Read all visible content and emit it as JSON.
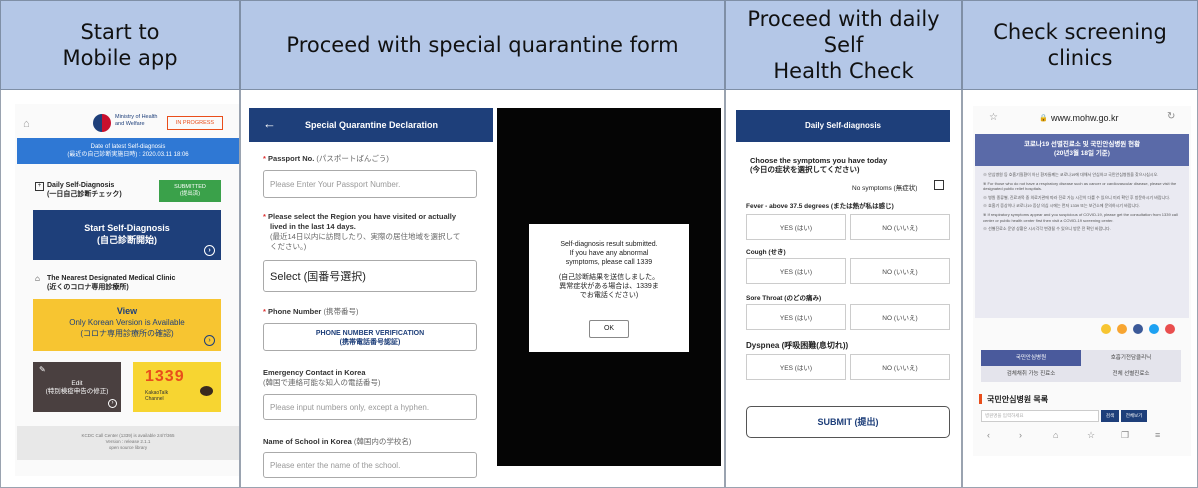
{
  "headers": {
    "col1": [
      "Start to",
      "Mobile app"
    ],
    "col2": "Proceed with special quarantine form",
    "col3": [
      "Proceed with daily Self",
      "Health Check"
    ],
    "col4": "Check screening clinics"
  },
  "app": {
    "ministry": [
      "Ministry of Health",
      "and Welfare"
    ],
    "status_badge": "IN PROGRESS",
    "latest_title": "Date of latest Self-diagnosis",
    "latest_sub": "(最近の自己診断実施日時) : 2020.03.11 18:06",
    "daily_title": "Daily Self-Diagnosis",
    "daily_sub": "(一日自己診断チェック)",
    "submitted": [
      "SUBMITTED",
      "(提出済)"
    ],
    "start_title": "Start Self-Diagnosis",
    "start_sub": "(自己診断開始)",
    "clinic_title": "The Nearest Designated Medical Clinic",
    "clinic_sub": "(近くのコロナ専用診療所)",
    "view_title": "View",
    "view_line2": "Only Korean Version is Available",
    "view_line3": "(コロナ専用診療所の確認)",
    "edit_title": "Edit",
    "edit_sub": "(特別検疫申告の修正)",
    "hotline_logo": "1339",
    "hotline_label": [
      "KakaoTalk",
      "Channel"
    ],
    "footer": [
      "KCDC Call Center (1339) is available 24/7/365",
      "Version : release 2.1.1",
      "open source library"
    ]
  },
  "form": {
    "title": "Special Quarantine Declaration",
    "passport_label": "Passport No.",
    "passport_label_jp": "(パスポートばんごう)",
    "passport_placeholder": "Please Enter Your Passport Number.",
    "region_label": [
      "Please select the Region you have visited or actually",
      "lived in the last 14 days."
    ],
    "region_label_jp": [
      "(最近14日以内に訪問したり、実際の居住地域を選択して",
      "ください。)"
    ],
    "region_select": "Select (国番号選択)",
    "phone_label": "Phone Number",
    "phone_label_jp": "(携帯番号)",
    "phone_button": "PHONE NUMBER VERIFICATION",
    "phone_button_jp": "(携帯電話番号認証)",
    "emergency_label": "Emergency Contact in Korea",
    "emergency_label_jp": "(韓国で連絡可能な知人の電話番号)",
    "emergency_placeholder": "Please input numbers only, except a hyphen.",
    "school_label": "Name of School in Korea",
    "school_label_jp": "(韓国内の学校名)",
    "school_placeholder": "Please enter the name of the school."
  },
  "dialog": {
    "lines": [
      "Self-diagnosis result submitted.",
      "If you have any abnormal",
      "symptoms, please call 1339"
    ],
    "lines_jp": [
      "(自己診断結果を送信しました。",
      "異常症状がある場合は、1339ま",
      "でお電話ください)"
    ],
    "ok": "OK"
  },
  "daily": {
    "title": "Daily Self-diagnosis",
    "choose": "Choose the symptoms you have today",
    "choose_jp": "(今日の症状を選択してください)",
    "no_symptoms": "No symptoms (無症状)",
    "symptoms": [
      {
        "label": "Fever - above 37.5 degrees (または熱が私は感じ)",
        "yes": "YES (はい)",
        "no": "NO (いいえ)"
      },
      {
        "label": "Cough (せき)",
        "yes": "YES (はい)",
        "no": "NO (いいえ)"
      },
      {
        "label": "Sore Throat (のどの痛み)",
        "yes": "YES (はい)",
        "no": "NO (いいえ)"
      },
      {
        "label": "Dyspnea (呼吸困難(息切れ))",
        "yes": "YES (はい)",
        "no": "NO (いいえ)"
      }
    ],
    "submit": "SUBMIT (提出)"
  },
  "browser": {
    "url": "www.mohw.go.kr",
    "banner_title": "코로나19 선별진료소 및 국민안심병원 현황",
    "banner_sub": "(20년3월 18일 기준)",
    "notes": [
      "※ 안심병원 등 호흡기질환이 아닌 환자들께는 코로나19에 대해서 안심하고 국민안심병원을 찾으시십시오.",
      "※ For those who do not have a respiratory disease such as cancer or cardiovascular disease, please visit the designated public relief hospitals.",
      "※ 병원 종류별, 진료과목 중 의료기관에 따라 진료 가능 시간이 다를 수 있으니 미리 확인 후 방문하시기 바랍니다.",
      "※ 호흡기 증상이나 코로나19 증상 의심 시에는 먼저 1339 또는 보건소에 문의하시기 바랍니다.",
      "※ If respiratory symptoms appear and you suspicious of COVID-19, please get the consultation from 1339 call center or public health center first then visit a COVID-19 screening center.",
      "※ 선별진료소 운영 상황은 시시각각 변경될 수 있으니 방문 전 확인 바랍니다."
    ],
    "tabs": [
      "국민안심병원",
      "호흡기전담클리닉",
      "검체채취 가능 진료소",
      "전체 선별진료소"
    ],
    "list_title": "국민안심병원 목록",
    "search_placeholder": "병원명을 입력하세요",
    "search_buttons": [
      "검색",
      "전체보기"
    ]
  },
  "colors": {
    "header_bg": "#b4c7e7",
    "navy": "#1e3f7a",
    "app_blue": "#2f78d4",
    "yellow": "#f7c531"
  }
}
